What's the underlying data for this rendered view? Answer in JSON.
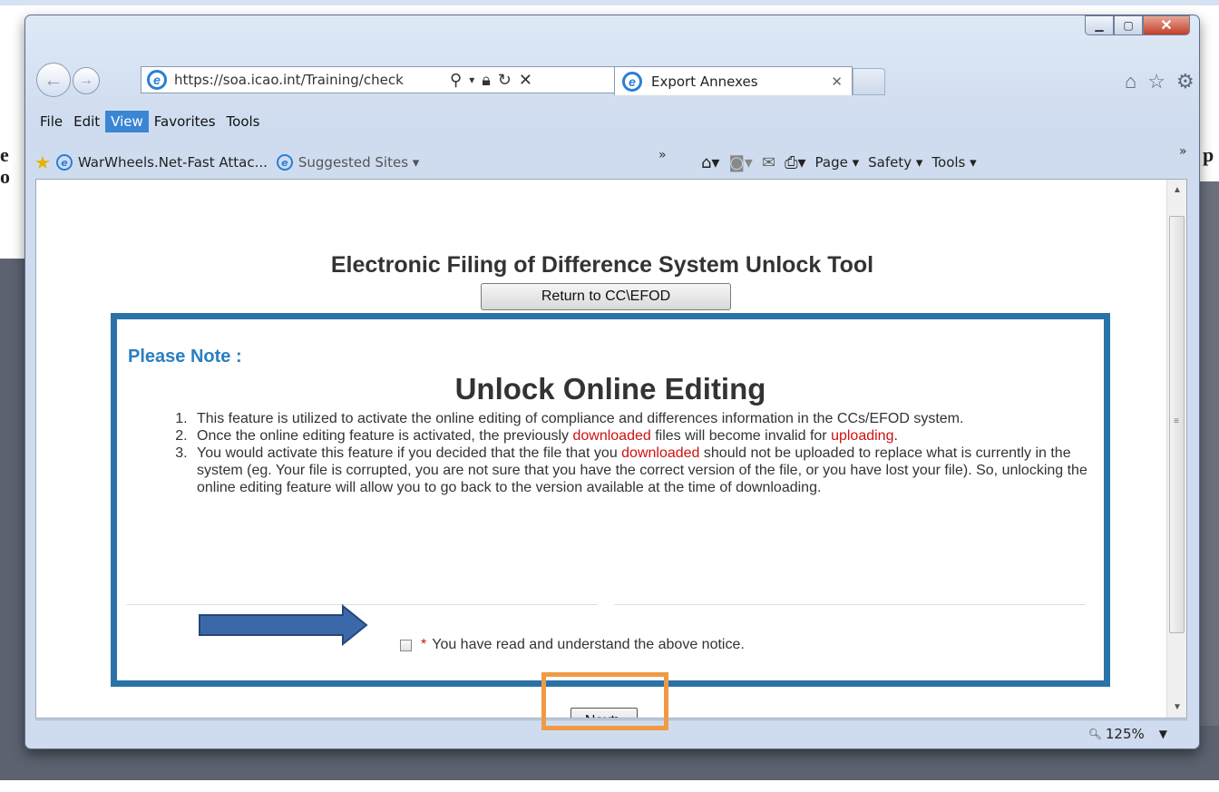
{
  "browser": {
    "address_url": "https://soa.icao.int/Training/check",
    "tab_title": "Export Annexes",
    "menu": [
      "File",
      "Edit",
      "View",
      "Favorites",
      "Tools"
    ],
    "active_menu": "View",
    "favorites": {
      "link1": "WarWheels.Net-Fast Attac...",
      "link2": "Suggested Sites ▾"
    },
    "command_bar": {
      "page": "Page ▾",
      "safety": "Safety ▾",
      "tools": "Tools ▾"
    },
    "zoom": "125%"
  },
  "page": {
    "title": "Electronic Filing of Difference System Unlock Tool",
    "return_button": "Return to CC\\EFOD",
    "notice_label": "Please Note :",
    "notice_heading": "Unlock Online Editing",
    "items": {
      "item1": "This feature is utilized to activate the online editing of compliance and differences information in the CCs/EFOD system.",
      "item2_a": "Once the online editing feature is activated, the previously ",
      "item2_red1": "downloaded",
      "item2_b": " files will become invalid for ",
      "item2_red2": "uploading",
      "item2_c": ".",
      "item3_a": "You would activate this feature if you decided that the file that you ",
      "item3_red": "downloaded",
      "item3_b": " should not be uploaded to replace what is currently in the system (eg. Your file is corrupted, you are not sure that you have the correct version of the file, or you have lost your file). So, unlocking the online editing feature will allow you to go back to the version available at the time of downloading."
    },
    "checkbox_asterisk": "*",
    "checkbox_label": "You have read and understand the above notice.",
    "next_button": "Next>"
  },
  "colors": {
    "notice_border": "#2a73a8",
    "please_note": "#2a7fc0",
    "highlight_red": "#d01010",
    "annotation_arrow": "#3b68a8",
    "annotation_box": "#f19a45"
  },
  "icons": [
    "back-arrow-icon",
    "forward-arrow-icon",
    "ie-logo-icon",
    "search-icon",
    "lock-icon",
    "refresh-icon",
    "stop-icon",
    "home-icon",
    "star-icon",
    "gear-icon",
    "favorites-star-icon",
    "rss-icon",
    "mail-icon",
    "print-icon",
    "zoom-icon"
  ]
}
